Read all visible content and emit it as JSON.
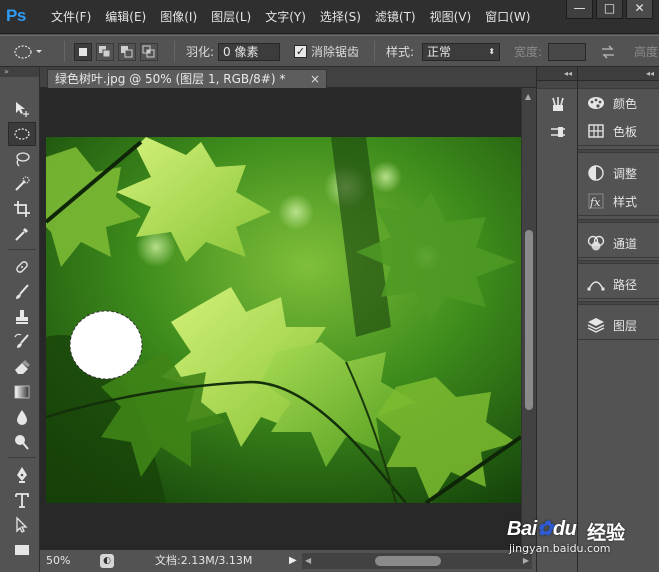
{
  "app": {
    "logo": "Ps"
  },
  "menu": [
    "文件(F)",
    "编辑(E)",
    "图像(I)",
    "图层(L)",
    "文字(Y)",
    "选择(S)",
    "滤镜(T)",
    "视图(V)",
    "窗口(W)"
  ],
  "window_controls": {
    "minimize": "—",
    "restore": "□",
    "close": "✕"
  },
  "options": {
    "feather_label": "羽化:",
    "feather_value": "0 像素",
    "antialias_label": "消除锯齿",
    "antialias_checked": "✓",
    "style_label": "样式:",
    "style_value": "正常",
    "width_label": "宽度:",
    "height_label": "高度:"
  },
  "document": {
    "tab_title": "绿色树叶.jpg @ 50% (图层 1, RGB/8#) *",
    "tab_close": "×"
  },
  "status": {
    "zoom": "50%",
    "doc_info": "文档:2.13M/3.13M",
    "arrow": "▶"
  },
  "panels": {
    "color": "颜色",
    "swatches": "色板",
    "adjustments": "调整",
    "styles": "样式",
    "channels": "通道",
    "paths": "路径",
    "layers": "图层"
  },
  "watermark": {
    "brand_left": "Bai",
    "brand_right": "du",
    "brand_cn": "经验",
    "url": "jingyan.baidu.com"
  },
  "colors": {
    "ps_blue": "#2f9cf3",
    "panel_bg": "#535353",
    "canvas_bg": "#282828"
  }
}
